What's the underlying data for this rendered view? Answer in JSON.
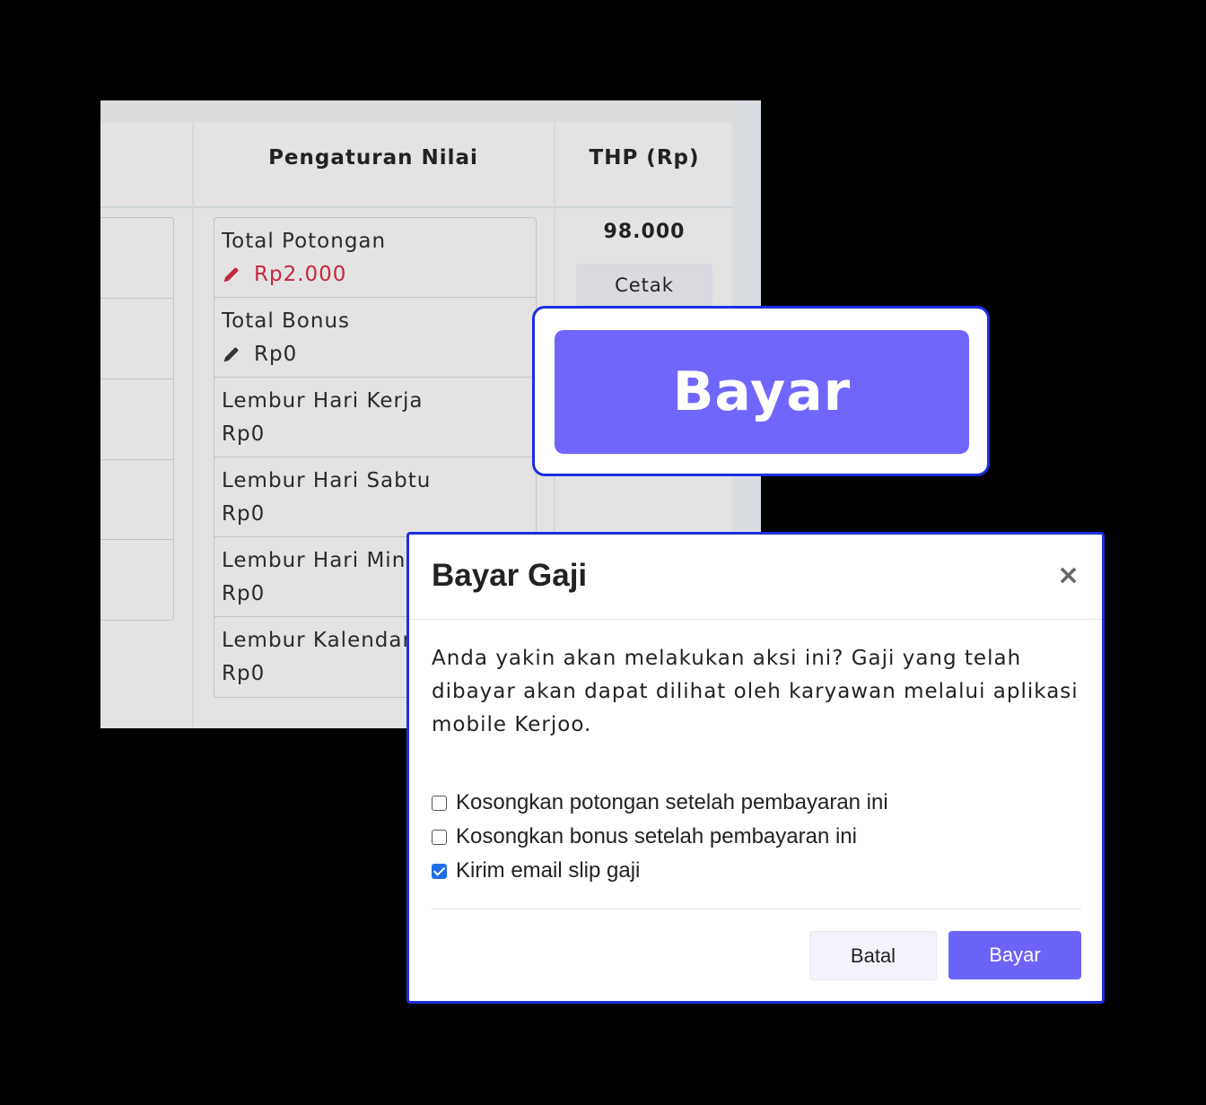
{
  "table": {
    "columns": {
      "settings": "Pengaturan Nilai",
      "thp": "THP (Rp)"
    },
    "settings_items": [
      {
        "label": "Total Potongan",
        "value": "Rp2.000",
        "editable": true,
        "value_color": "#c5283d"
      },
      {
        "label": "Total Bonus",
        "value": "Rp0",
        "editable": true
      },
      {
        "label": "Lembur Hari Kerja",
        "value": "Rp0"
      },
      {
        "label": "Lembur Hari Sabtu",
        "value": "Rp0"
      },
      {
        "label": "Lembur Hari Ming",
        "value": "Rp0"
      },
      {
        "label": "Lembur Kalendar",
        "value": "Rp0"
      }
    ],
    "thp_value": "98.000",
    "print_label": "Cetak"
  },
  "zoom": {
    "button_label": "Bayar"
  },
  "modal": {
    "title": "Bayar Gaji",
    "close": "×",
    "message_lines": [
      "Anda yakin akan melakukan aksi ini? Gaji yang telah",
      "dibayar akan dapat dilihat oleh karyawan melalui aplikasi",
      "mobile Kerjoo."
    ],
    "options": [
      {
        "label": "Kosongkan potongan setelah pembayaran ini",
        "checked": false
      },
      {
        "label": "Kosongkan bonus setelah pembayaran ini",
        "checked": false
      },
      {
        "label": "Kirim email slip gaji",
        "checked": true
      }
    ],
    "cancel_label": "Batal",
    "confirm_label": "Bayar"
  },
  "colors": {
    "accent": "#6c63f8",
    "modal_border": "#1d2fe0",
    "danger": "#c5283d",
    "checkbox_checked": "#1f6feb"
  }
}
